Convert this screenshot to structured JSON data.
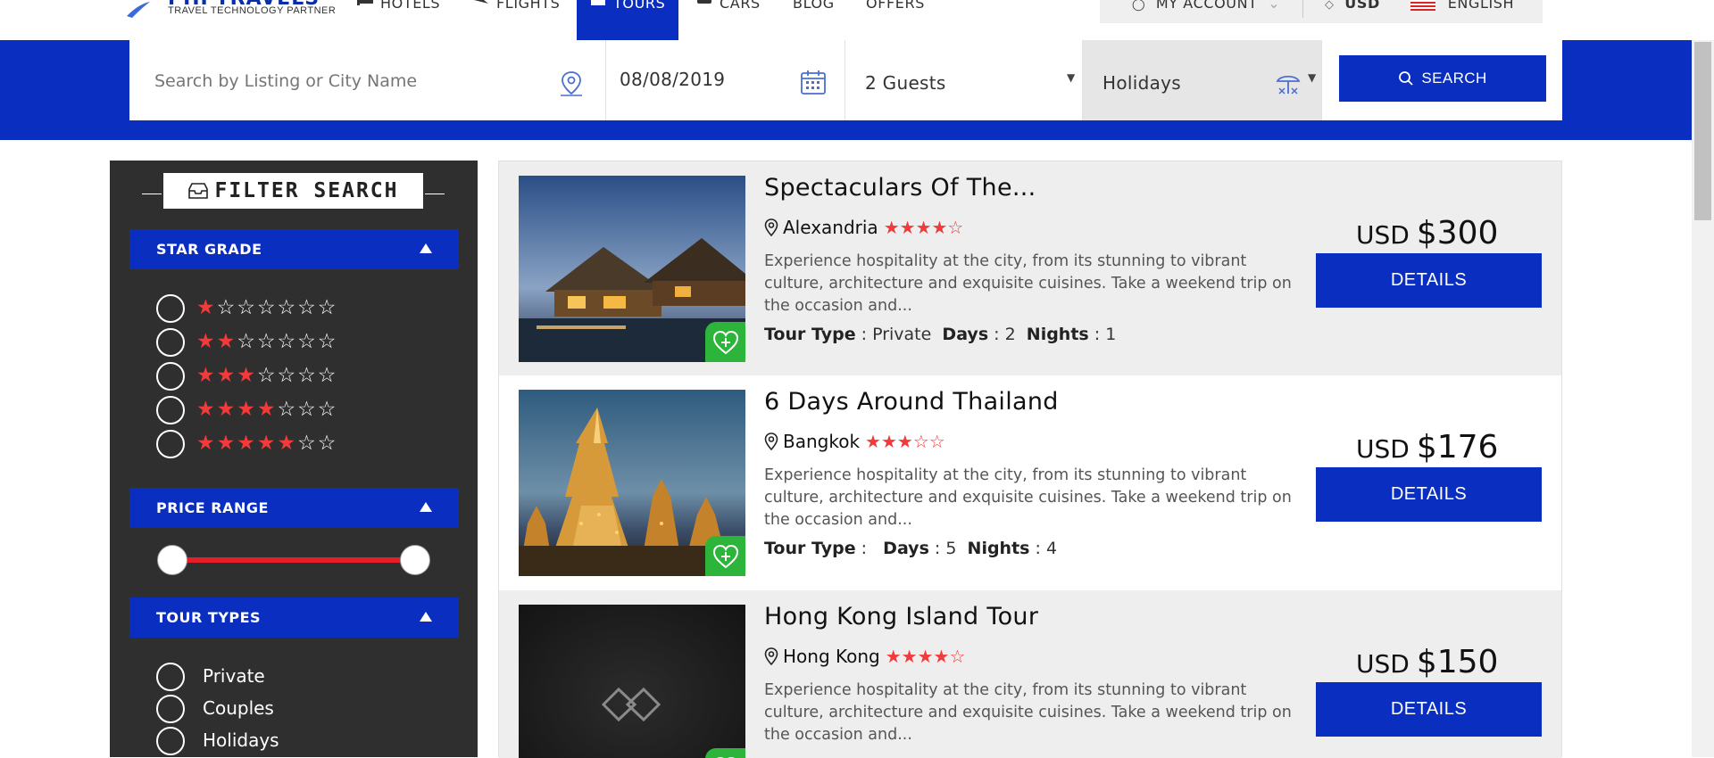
{
  "brand": {
    "name": "PHPTRAVELS",
    "tagline": "TRAVEL TECHNOLOGY PARTNER",
    "color": "#0a2fc0"
  },
  "nav": {
    "items": [
      {
        "label": "HOTELS",
        "icon": "bed-icon"
      },
      {
        "label": "FLIGHTS",
        "icon": "plane-icon"
      },
      {
        "label": "TOURS",
        "icon": "suitcase-icon",
        "active": true
      },
      {
        "label": "CARS",
        "icon": "car-icon"
      },
      {
        "label": "BLOG"
      },
      {
        "label": "OFFERS"
      }
    ],
    "account_label": "MY ACCOUNT",
    "currency_label": "USD",
    "language_label": "ENGLISH"
  },
  "search": {
    "listing_placeholder": "Search by Listing or City Name",
    "date_value": "08/08/2019",
    "guests_value": "2 Guests",
    "tour_type_value": "Holidays",
    "button_label": "SEARCH"
  },
  "filter": {
    "title": "FILTER SEARCH",
    "star_grade_label": "STAR GRADE",
    "star_rows": [
      "★☆☆☆☆☆☆",
      "★★☆☆☆☆☆",
      "★★★☆☆☆☆",
      "★★★★☆☆☆",
      "★★★★★☆☆"
    ],
    "star_filled_counts": [
      1,
      2,
      3,
      4,
      5
    ],
    "price_range_label": "PRICE RANGE",
    "price_range_selected": [
      0,
      1
    ],
    "tour_types_label": "TOUR TYPES",
    "tour_types": [
      "Private",
      "Couples",
      "Holidays"
    ]
  },
  "results": [
    {
      "title": "Spectaculars Of The...",
      "location": "Alexandria",
      "stars": "★★★★☆",
      "rating": 4,
      "description": "Experience hospitality at the city, from its stunning to vibrant culture, architecture and exquisite cuisines. Take a weekend trip on the occasion and...",
      "tour_type_label": "Tour Type",
      "tour_type": "Private",
      "days_label": "Days",
      "days": "2",
      "nights_label": "Nights",
      "nights": "1",
      "currency": "USD",
      "price": "$300",
      "details_label": "DETAILS"
    },
    {
      "title": "6 Days Around Thailand",
      "location": "Bangkok",
      "stars": "★★★☆☆",
      "rating": 3,
      "description": "Experience hospitality at the city, from its stunning to vibrant culture, architecture and exquisite cuisines. Take a weekend trip on the occasion and...",
      "tour_type_label": "Tour Type",
      "tour_type": "",
      "days_label": "Days",
      "days": "5",
      "nights_label": "Nights",
      "nights": "4",
      "currency": "USD",
      "price": "$176",
      "details_label": "DETAILS"
    },
    {
      "title": "Hong Kong Island Tour",
      "location": "Hong Kong",
      "stars": "★★★★☆",
      "rating": 4,
      "description": "Experience hospitality at the city, from its stunning to vibrant culture, architecture and exquisite cuisines. Take a weekend trip on the occasion and...",
      "currency": "USD",
      "price": "$150",
      "details_label": "DETAILS"
    }
  ],
  "colors": {
    "primary": "#0a2fc0",
    "star": "#f33a3a",
    "favorite": "#2db43a",
    "sidebar": "#2f2f2f"
  }
}
